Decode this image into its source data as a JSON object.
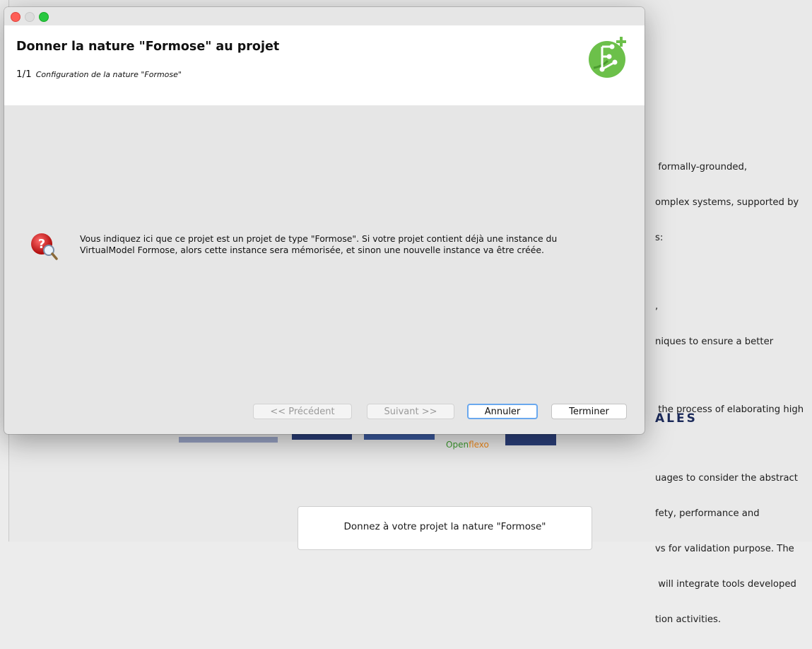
{
  "background": {
    "description_lines": [
      " formally-grounded,",
      "omplex systems, supported by",
      "s:",
      "",
      ",",
      "niques to ensure a better",
      "",
      " the process of elaborating high",
      "",
      "uages to consider the abstract",
      "fety, performance and",
      "vs for validation purpose. The",
      " will integrate tools developed",
      "tion activities."
    ],
    "partner_logo_text": "ALES",
    "openflexo_logo": {
      "part1": "Open",
      "part2": "flexo"
    },
    "nature_button_label": "Donnez à votre projet la nature \"Formose\""
  },
  "dialog": {
    "title": "Donner la nature \"Formose\" au projet",
    "step_number": "1/1",
    "step_label": "Configuration de la nature \"Formose\"",
    "app_icon": "formose-logo-icon",
    "message_icon": "help-question-icon",
    "message": "Vous indiquez ici que ce projet est un projet de type \"Formose\". Si votre projet contient déjà une instance du VirtualModel Formose, alors cette instance sera mémorisée, et sinon une nouvelle instance va être créée.",
    "buttons": {
      "previous": "<< Précédent",
      "next": "Suivant >>",
      "cancel": "Annuler",
      "finish": "Terminer"
    }
  },
  "colors": {
    "close": "#fe5f57",
    "maximize": "#28c840",
    "logo_green": "#6cc04a",
    "focus_ring": "#6aa8ee"
  }
}
